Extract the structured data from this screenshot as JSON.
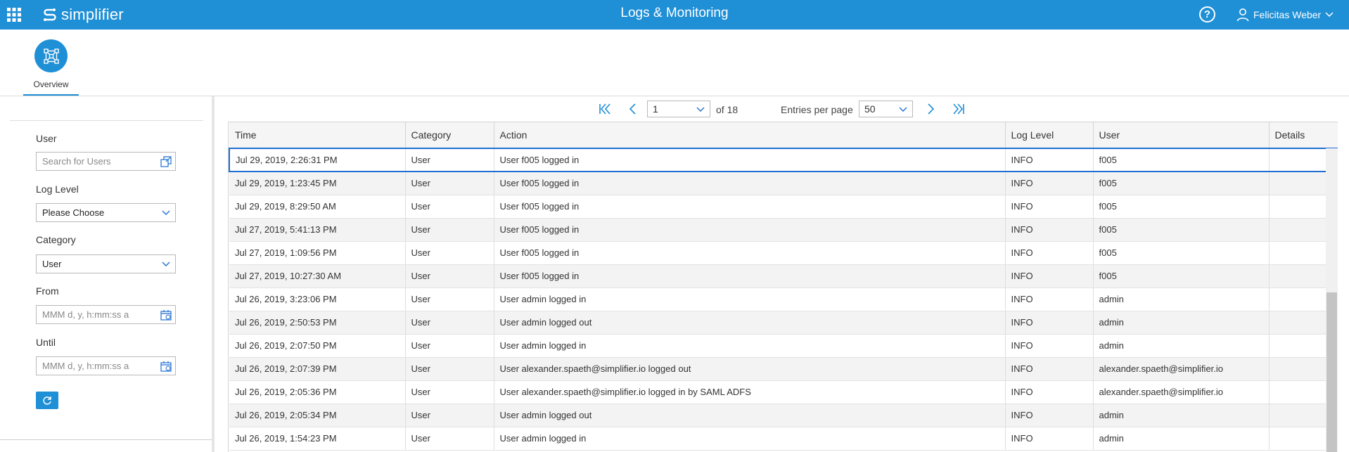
{
  "header": {
    "logo_text": "simplifier",
    "title": "Logs & Monitoring",
    "help_label": "?",
    "user_name": "Felicitas Weber"
  },
  "tabs": [
    {
      "label": "Overview",
      "icon": "network-icon"
    }
  ],
  "filters": {
    "user_label": "User",
    "user_placeholder": "Search for Users",
    "loglevel_label": "Log Level",
    "loglevel_value": "Please Choose",
    "category_label": "Category",
    "category_value": "User",
    "from_label": "From",
    "from_placeholder": "MMM d, y, h:mm:ss a",
    "until_label": "Until",
    "until_placeholder": "MMM d, y, h:mm:ss a"
  },
  "pager": {
    "current_page": "1",
    "of_text": "of 18",
    "entries_label": "Entries per page",
    "entries_value": "50"
  },
  "table": {
    "columns": [
      "Time",
      "Category",
      "Action",
      "Log Level",
      "User",
      "Details"
    ],
    "rows": [
      [
        "Jul 29, 2019, 2:26:31 PM",
        "User",
        "User f005 logged in",
        "INFO",
        "f005",
        ""
      ],
      [
        "Jul 29, 2019, 1:23:45 PM",
        "User",
        "User f005 logged in",
        "INFO",
        "f005",
        ""
      ],
      [
        "Jul 29, 2019, 8:29:50 AM",
        "User",
        "User f005 logged in",
        "INFO",
        "f005",
        ""
      ],
      [
        "Jul 27, 2019, 5:41:13 PM",
        "User",
        "User f005 logged in",
        "INFO",
        "f005",
        ""
      ],
      [
        "Jul 27, 2019, 1:09:56 PM",
        "User",
        "User f005 logged in",
        "INFO",
        "f005",
        ""
      ],
      [
        "Jul 27, 2019, 10:27:30 AM",
        "User",
        "User f005 logged in",
        "INFO",
        "f005",
        ""
      ],
      [
        "Jul 26, 2019, 3:23:06 PM",
        "User",
        "User admin logged in",
        "INFO",
        "admin",
        ""
      ],
      [
        "Jul 26, 2019, 2:50:53 PM",
        "User",
        "User admin logged out",
        "INFO",
        "admin",
        ""
      ],
      [
        "Jul 26, 2019, 2:07:50 PM",
        "User",
        "User admin logged in",
        "INFO",
        "admin",
        ""
      ],
      [
        "Jul 26, 2019, 2:07:39 PM",
        "User",
        "User alexander.spaeth@simplifier.io logged out",
        "INFO",
        "alexander.spaeth@simplifier.io",
        ""
      ],
      [
        "Jul 26, 2019, 2:05:36 PM",
        "User",
        "User alexander.spaeth@simplifier.io logged in by SAML ADFS",
        "INFO",
        "alexander.spaeth@simplifier.io",
        ""
      ],
      [
        "Jul 26, 2019, 2:05:34 PM",
        "User",
        "User admin logged out",
        "INFO",
        "admin",
        ""
      ],
      [
        "Jul 26, 2019, 1:54:23 PM",
        "User",
        "User admin logged in",
        "INFO",
        "admin",
        ""
      ]
    ],
    "selected_row": 0
  },
  "colors": {
    "brand": "#1f8fd6",
    "selection": "#1f6fd2"
  }
}
